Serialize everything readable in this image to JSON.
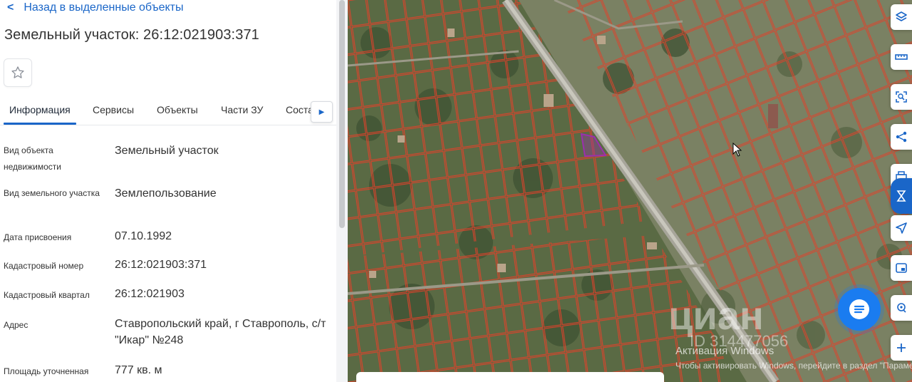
{
  "nav": {
    "back_label": "Назад в выделенные объекты"
  },
  "header": {
    "title": "Земельный участок: 26:12:021903:371"
  },
  "tabs": [
    {
      "label": "Информация",
      "active": true
    },
    {
      "label": "Сервисы",
      "active": false
    },
    {
      "label": "Объекты",
      "active": false
    },
    {
      "label": "Части ЗУ",
      "active": false
    },
    {
      "label": "Соста",
      "active": false
    }
  ],
  "fields": [
    {
      "label": "Вид объекта недвижимости",
      "value": "Земельный участок"
    },
    {
      "label": "Вид земельного участка",
      "value": "Землепользование"
    },
    {
      "label": "Дата присвоения",
      "value": "07.10.1992"
    },
    {
      "label": "Кадастровый номер",
      "value": "26:12:021903:371"
    },
    {
      "label": "Кадастровый квартал",
      "value": "26:12:021903"
    },
    {
      "label": "Адрес",
      "value": "Ставропольский край, г Ставрополь, с/т \"Икар\" №248"
    },
    {
      "label": "Площадь уточненная",
      "value": "777 кв. м"
    }
  ],
  "map": {
    "controls": [
      "layers-icon",
      "ruler-icon",
      "select-area-icon",
      "share-icon",
      "print-icon",
      "navigate-icon",
      "fullscreen-icon",
      "locate-icon",
      "zoom-in-icon"
    ],
    "watermark": "циан",
    "watermark_id": "ID 314477056",
    "activation_title": "Активация Windows",
    "activation_text": "Чтобы активировать Windows, перейдите в раздел \"Параметры\"."
  },
  "colors": {
    "accent": "#1a66c8",
    "parcel": "#e0412a",
    "highlight": "#9b2fae",
    "chat": "#1a7cf0"
  }
}
